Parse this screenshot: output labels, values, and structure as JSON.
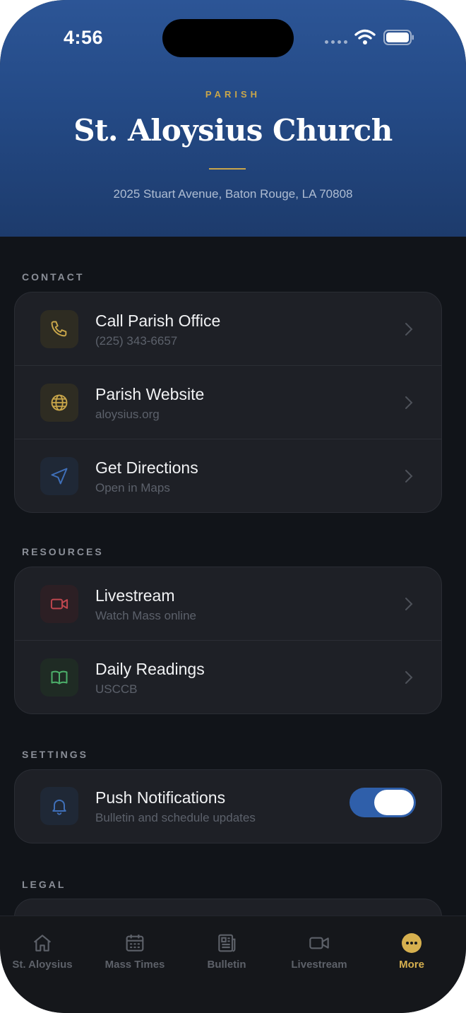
{
  "status_bar": {
    "time": "4:56"
  },
  "header": {
    "eyebrow": "PARISH",
    "title": "St. Aloysius Church",
    "address": "2025 Stuart Avenue, Baton Rouge, LA 70808"
  },
  "sections": {
    "contact": {
      "label": "CONTACT",
      "items": [
        {
          "title": "Call Parish Office",
          "subtitle": "(225) 343-6657",
          "icon": "phone-icon"
        },
        {
          "title": "Parish Website",
          "subtitle": "aloysius.org",
          "icon": "globe-icon"
        },
        {
          "title": "Get Directions",
          "subtitle": "Open in Maps",
          "icon": "navigation-icon"
        }
      ]
    },
    "resources": {
      "label": "RESOURCES",
      "items": [
        {
          "title": "Livestream",
          "subtitle": "Watch Mass online",
          "icon": "video-icon"
        },
        {
          "title": "Daily Readings",
          "subtitle": "USCCB",
          "icon": "book-icon"
        }
      ]
    },
    "settings": {
      "label": "SETTINGS",
      "items": [
        {
          "title": "Push Notifications",
          "subtitle": "Bulletin and schedule updates",
          "icon": "bell-icon",
          "toggle_on": true
        }
      ]
    },
    "legal": {
      "label": "LEGAL"
    }
  },
  "tabbar": {
    "tabs": [
      {
        "label": "St. Aloysius",
        "icon": "home-icon",
        "active": false
      },
      {
        "label": "Mass Times",
        "icon": "calendar-icon",
        "active": false
      },
      {
        "label": "Bulletin",
        "icon": "newspaper-icon",
        "active": false
      },
      {
        "label": "Livestream",
        "icon": "video-icon",
        "active": false
      },
      {
        "label": "More",
        "icon": "more-icon",
        "active": true
      }
    ]
  },
  "colors": {
    "accent_gold": "#c9a64a",
    "header_blue": "#2c5596",
    "toggle_blue": "#2f5faa",
    "background": "#111419"
  }
}
